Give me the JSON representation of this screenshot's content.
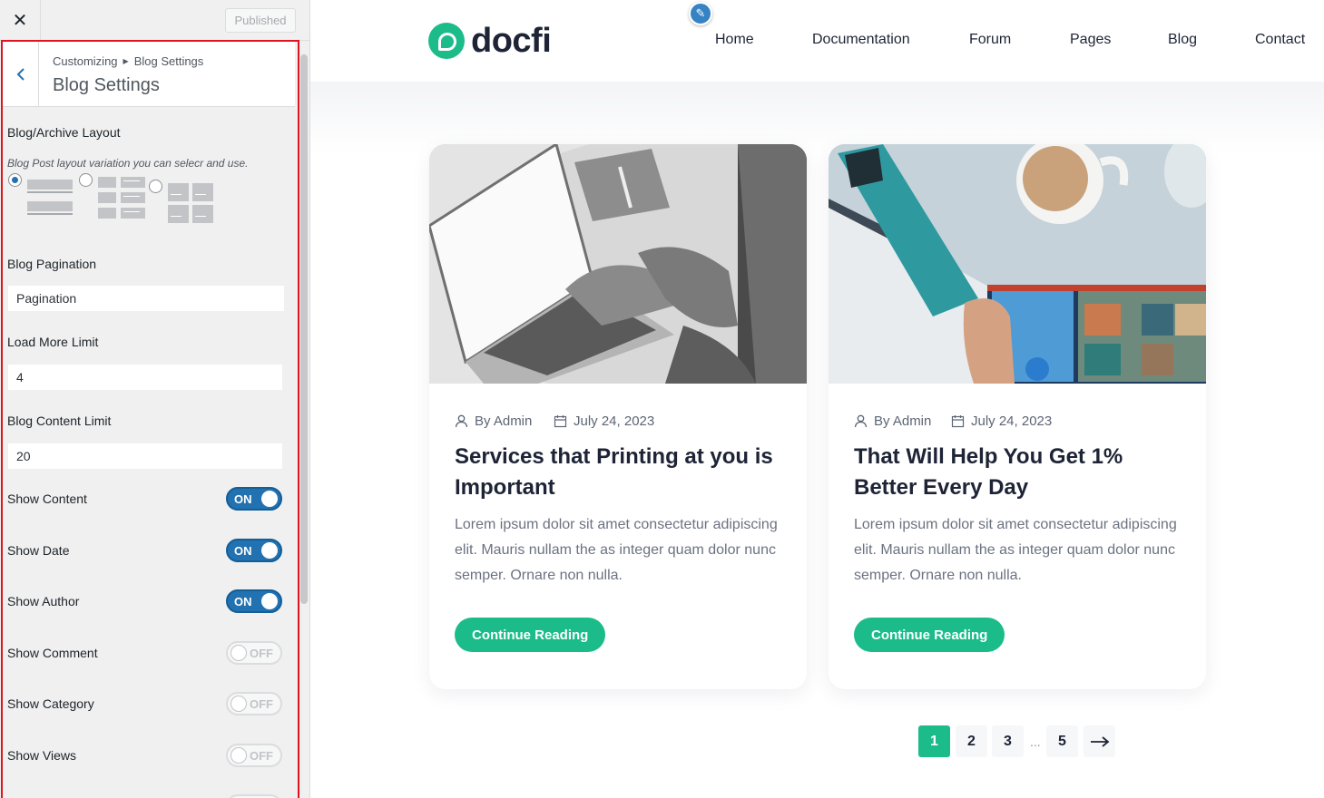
{
  "customizer": {
    "published_label": "Published",
    "breadcrumb": {
      "root": "Customizing",
      "current": "Blog Settings"
    },
    "section_title": "Blog Settings",
    "layout": {
      "label": "Blog/Archive Layout",
      "description": "Blog Post layout variation you can selecr and use.",
      "selected_index": 0
    },
    "pagination": {
      "label": "Blog Pagination",
      "value": "Pagination"
    },
    "load_more": {
      "label": "Load More Limit",
      "value": "4"
    },
    "content_limit": {
      "label": "Blog Content Limit",
      "value": "20"
    },
    "toggles": [
      {
        "label": "Show Content",
        "state": "ON"
      },
      {
        "label": "Show Date",
        "state": "ON"
      },
      {
        "label": "Show Author",
        "state": "ON"
      },
      {
        "label": "Show Comment",
        "state": "OFF"
      },
      {
        "label": "Show Category",
        "state": "OFF"
      },
      {
        "label": "Show Views",
        "state": "OFF"
      }
    ],
    "colors": {
      "accent": "#2271b1",
      "highlight_frame": "#e0141e"
    }
  },
  "site": {
    "logo_text": "docfi",
    "nav": [
      "Home",
      "Documentation",
      "Forum",
      "Pages",
      "Blog",
      "Contact"
    ],
    "posts": [
      {
        "author": "By Admin",
        "date": "July 24, 2023",
        "title": "Services that Printing at you is Important",
        "excerpt": "Lorem ipsum dolor sit amet consectetur adipiscing elit. Mauris nullam the as integer quam dolor nunc semper. Ornare non nulla.",
        "button": "Continue Reading"
      },
      {
        "author": "By Admin",
        "date": "July 24, 2023",
        "title": "That Will Help You Get 1% Better Every Day",
        "excerpt": "Lorem ipsum dolor sit amet consectetur adipiscing elit. Mauris nullam the as integer quam dolor nunc semper. Ornare non nulla.",
        "button": "Continue Reading"
      }
    ],
    "pagination": {
      "pages": [
        "1",
        "2",
        "3",
        "5"
      ],
      "ellipsis": "...",
      "current": "1",
      "next_icon": "arrow-right-icon"
    },
    "colors": {
      "brand": "#1bbc8a",
      "heading": "#1e2436"
    }
  }
}
